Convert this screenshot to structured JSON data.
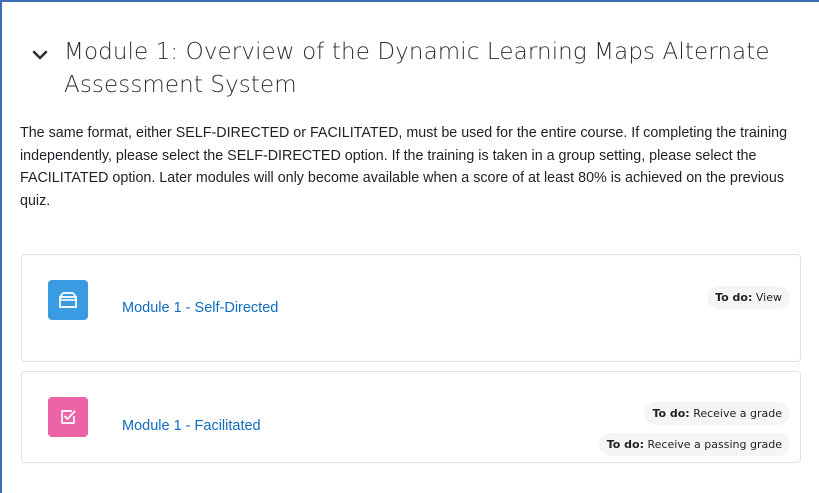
{
  "section": {
    "title": "Module 1: Overview of the Dynamic Learning Maps Alternate Assessment System",
    "summary": "The same format, either SELF-DIRECTED or FACILITATED, must be used for the entire course. If completing the training independently, please select the SELF-DIRECTED option. If the training is taken in a group setting, please select the FACILITATED option. Later modules will only become available when a score of at least 80% is achieved on the previous quiz."
  },
  "activities": [
    {
      "name": "Module 1 - Self-Directed",
      "icon": "package-icon",
      "icon_color": "#399be2",
      "completion": [
        {
          "label": "To do:",
          "text": "View"
        }
      ]
    },
    {
      "name": "Module 1 - Facilitated",
      "icon": "checkbox-edit-icon",
      "icon_color": "#ed64a6",
      "completion": [
        {
          "label": "To do:",
          "text": "Receive a grade"
        },
        {
          "label": "To do:",
          "text": "Receive a passing grade"
        }
      ]
    }
  ],
  "colors": {
    "link": "#0f6cbf",
    "frame": "#3b6fb4"
  }
}
